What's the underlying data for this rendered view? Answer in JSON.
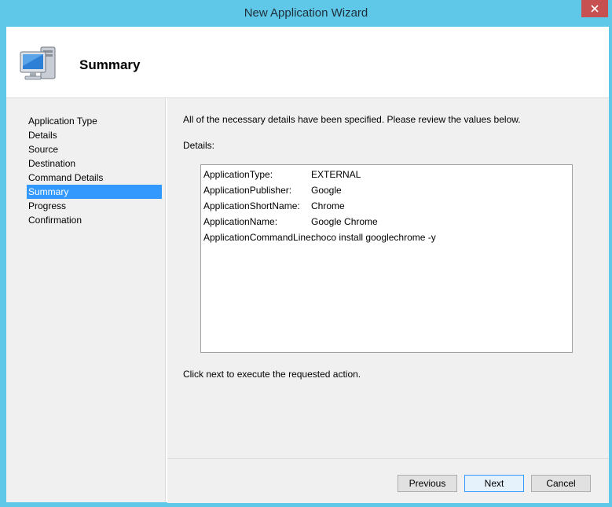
{
  "window": {
    "title": "New Application Wizard",
    "close_label": "Close"
  },
  "header": {
    "title": "Summary",
    "icon": "computer-icon"
  },
  "sidebar": {
    "items": [
      {
        "label": "Application Type",
        "active": false
      },
      {
        "label": "Details",
        "active": false
      },
      {
        "label": "Source",
        "active": false
      },
      {
        "label": "Destination",
        "active": false
      },
      {
        "label": "Command Details",
        "active": false
      },
      {
        "label": "Summary",
        "active": true
      },
      {
        "label": "Progress",
        "active": false
      },
      {
        "label": "Confirmation",
        "active": false
      }
    ]
  },
  "main": {
    "intro": "All of the necessary details have been specified.  Please review the values below.",
    "details_label": "Details:",
    "details": [
      {
        "key": "ApplicationType:",
        "value": "EXTERNAL"
      },
      {
        "key": "ApplicationPublisher:",
        "value": "Google"
      },
      {
        "key": "ApplicationShortName:",
        "value": "Chrome"
      },
      {
        "key": "ApplicationName:",
        "value": "Google Chrome"
      },
      {
        "key": "ApplicationCommandLine:",
        "value": "choco install googlechrome -y"
      }
    ],
    "footer_note": "Click next to execute the requested action."
  },
  "buttons": {
    "previous": "Previous",
    "next": "Next",
    "cancel": "Cancel"
  },
  "colors": {
    "title_bar": "#5fc8e8",
    "selection": "#3399ff",
    "close_button": "#c75050"
  }
}
